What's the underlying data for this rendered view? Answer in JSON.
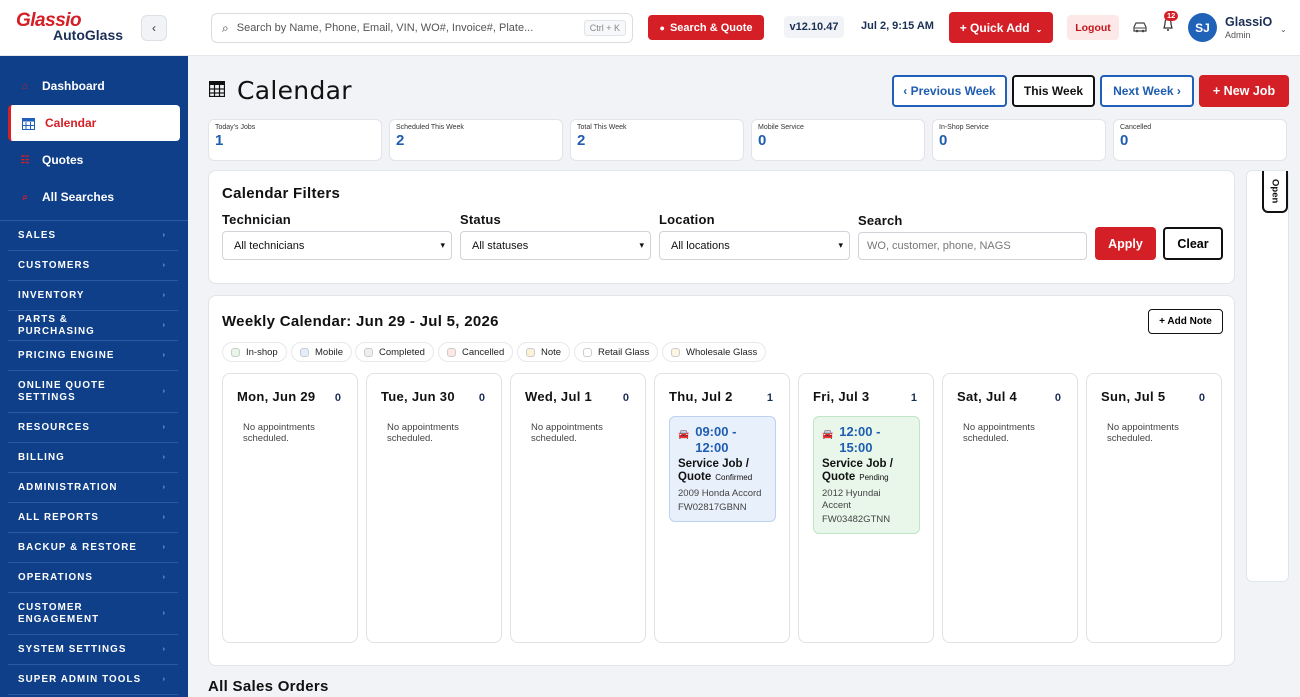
{
  "brand": {
    "line1": "Glassio",
    "line2": "AutoGlass"
  },
  "sidebar": {
    "main": [
      {
        "label": "Dashboard"
      },
      {
        "label": "Calendar"
      },
      {
        "label": "Quotes"
      },
      {
        "label": "All Searches"
      }
    ],
    "sections": [
      {
        "label": "SALES"
      },
      {
        "label": "CUSTOMERS"
      },
      {
        "label": "INVENTORY"
      },
      {
        "label": "PARTS & PURCHASING"
      },
      {
        "label": "PRICING ENGINE"
      },
      {
        "label": "ONLINE QUOTE SETTINGS"
      },
      {
        "label": "RESOURCES"
      },
      {
        "label": "BILLING"
      },
      {
        "label": "ADMINISTRATION"
      },
      {
        "label": "ALL REPORTS"
      },
      {
        "label": "BACKUP & RESTORE"
      },
      {
        "label": "OPERATIONS"
      },
      {
        "label": "CUSTOMER ENGAGEMENT"
      },
      {
        "label": "SYSTEM SETTINGS"
      },
      {
        "label": "SUPER ADMIN TOOLS"
      }
    ]
  },
  "header": {
    "search_placeholder": "Search by Name, Phone, Email, VIN, WO#, Invoice#, Plate...",
    "shortcut": "Ctrl + K",
    "search_quote": "Search & Quote",
    "version": "v12.10.47",
    "datetime": "Jul 2, 9:15 AM",
    "quick_add": "+ Quick Add",
    "logout": "Logout",
    "notif_count": "12",
    "avatar": "SJ",
    "user_name": "GlassiO",
    "user_role": "Admin"
  },
  "page": {
    "title": "Calendar",
    "prev_week": "‹ Previous Week",
    "this_week": "This Week",
    "next_week": "Next Week ›",
    "new_job": "+ New Job"
  },
  "stats": [
    {
      "label": "Today's Jobs",
      "value": "1"
    },
    {
      "label": "Scheduled This Week",
      "value": "2"
    },
    {
      "label": "Total This Week",
      "value": "2"
    },
    {
      "label": "Mobile Service",
      "value": "0"
    },
    {
      "label": "In-Shop Service",
      "value": "0"
    },
    {
      "label": "Cancelled",
      "value": "0"
    }
  ],
  "filters": {
    "title": "Calendar Filters",
    "technician_label": "Technician",
    "technician_value": "All technicians",
    "status_label": "Status",
    "status_value": "All statuses",
    "location_label": "Location",
    "location_value": "All locations",
    "search_label": "Search",
    "search_placeholder": "WO, customer, phone, NAGS",
    "apply": "Apply",
    "clear": "Clear",
    "open_tab": "Open"
  },
  "weekly": {
    "title": "Weekly Calendar: Jun 29 - Jul 5, 2026",
    "add_note": "+ Add Note",
    "legend": [
      {
        "label": "In-shop",
        "color": "#e6f6e9"
      },
      {
        "label": "Mobile",
        "color": "#e3edfb"
      },
      {
        "label": "Completed",
        "color": "#eeeeee"
      },
      {
        "label": "Cancelled",
        "color": "#fde6e6"
      },
      {
        "label": "Note",
        "color": "#fdf1d6"
      },
      {
        "label": "Retail Glass",
        "color": "#ffffff"
      },
      {
        "label": "Wholesale Glass",
        "color": "#fdf5e3"
      }
    ],
    "empty_text": "No appointments scheduled.",
    "days": [
      {
        "name": "Mon, Jun 29",
        "count": "0"
      },
      {
        "name": "Tue, Jun 30",
        "count": "0"
      },
      {
        "name": "Wed, Jul 1",
        "count": "0"
      },
      {
        "name": "Thu, Jul 2",
        "count": "1",
        "appt": {
          "time": "09:00 - 12:00",
          "type": "Service Job / Quote",
          "status": "Confirmed",
          "vehicle": "2009 Honda Accord",
          "wo": "FW02817GBNN",
          "bg": "#e8f0fb",
          "border": "#bcd2ef"
        }
      },
      {
        "name": "Fri, Jul 3",
        "count": "1",
        "appt": {
          "time": "12:00 - 15:00",
          "type": "Service Job / Quote",
          "status": "Pending",
          "vehicle": "2012 Hyundai Accent",
          "wo": "FW03482GTNN",
          "bg": "#e8f7ea",
          "border": "#bfe6c6"
        }
      },
      {
        "name": "Sat, Jul 4",
        "count": "0"
      },
      {
        "name": "Sun, Jul 5",
        "count": "0"
      }
    ]
  },
  "orders_title": "All Sales Orders"
}
